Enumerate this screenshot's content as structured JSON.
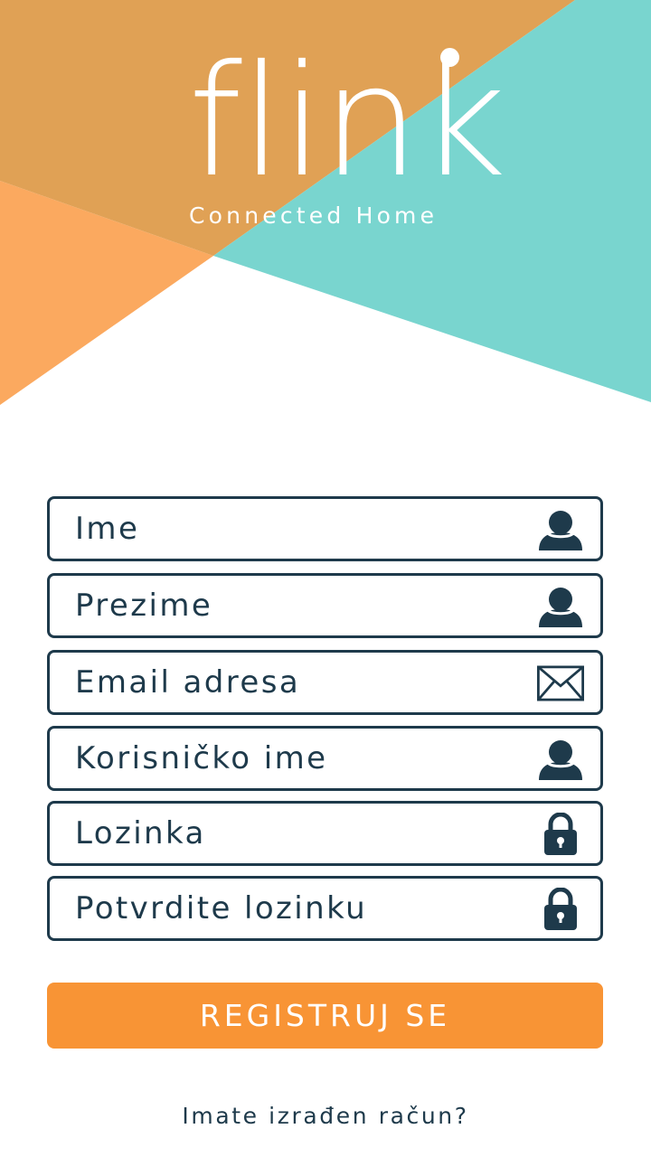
{
  "brand": {
    "logo_text": "flink",
    "tagline": "Connected Home"
  },
  "colors": {
    "orange_dark": "#e0a155",
    "orange_light": "#fba95f",
    "teal": "#79d5cf",
    "navy": "#1e3a4b",
    "button": "#f89435"
  },
  "form": {
    "fields": [
      {
        "placeholder": "Ime",
        "icon": "user-icon",
        "type": "text"
      },
      {
        "placeholder": "Prezime",
        "icon": "user-icon",
        "type": "text"
      },
      {
        "placeholder": "Email adresa",
        "icon": "envelope-icon",
        "type": "email"
      },
      {
        "placeholder": "Korisničko ime",
        "icon": "user-icon",
        "type": "text"
      },
      {
        "placeholder": "Lozinka",
        "icon": "lock-icon",
        "type": "password"
      },
      {
        "placeholder": "Potvrdite lozinku",
        "icon": "lock-icon",
        "type": "password"
      }
    ],
    "submit_label": "REGISTRUJ SE"
  },
  "footer": {
    "login_prompt": "Imate izrađen račun?"
  }
}
